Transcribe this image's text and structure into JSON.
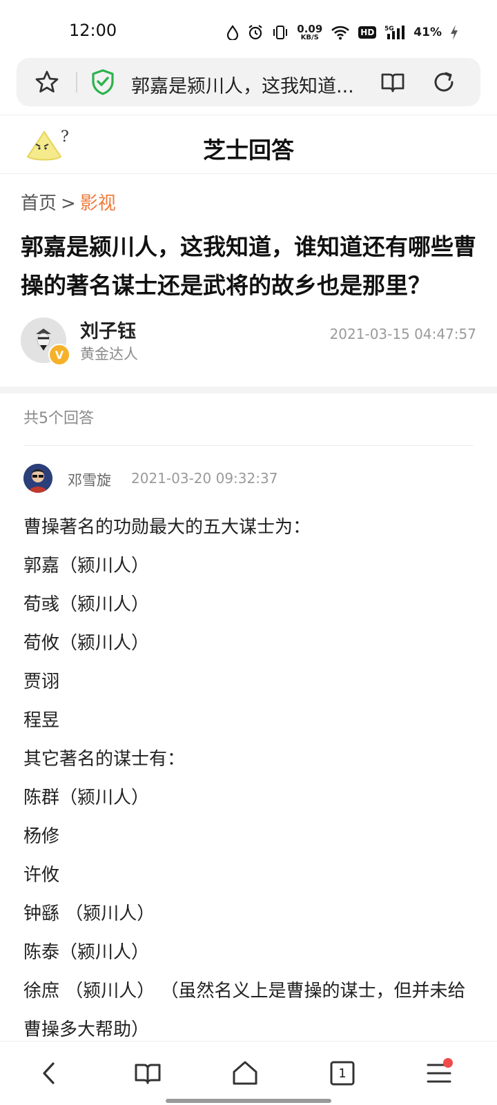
{
  "status_bar": {
    "time": "12:00",
    "net_speed_value": "0.09",
    "net_speed_unit": "KB/S",
    "hd_label": "HD",
    "network_label": "5G",
    "battery": "41%"
  },
  "address_bar": {
    "url_text": "郭嘉是颍川人，这我知道..."
  },
  "site": {
    "title": "芝士回答"
  },
  "breadcrumb": {
    "home": "首页",
    "separator": ">",
    "current": "影视"
  },
  "question": {
    "title": "郭嘉是颍川人，这我知道，谁知道还有哪些曹操的著名谋士还是武将的故乡也是那里？",
    "asker_name": "刘子钰",
    "asker_level": "黄金达人",
    "asker_badge": "V",
    "time": "2021-03-15 04:47:57"
  },
  "answers": {
    "count_label": "共5个回答",
    "first": {
      "author": "邓雪旋",
      "time": "2021-03-20 09:32:37",
      "lines": [
        "曹操著名的功勋最大的五大谋士为：",
        "郭嘉（颍川人）",
        "荀彧（颍川人）",
        "荀攸（颍川人）",
        "贾诩",
        "程昱",
        "其它著名的谋士有：",
        "陈群（颍川人）",
        "杨修",
        "许攸",
        "钟繇 （颍川人）",
        "陈泰（颍川人）",
        "徐庶 （颍川人） （虽然名义上是曹操的谋士，但并未给曹操多大帮助）"
      ]
    }
  },
  "bottom_nav": {
    "tabs_count": "1"
  },
  "colors": {
    "accent_orange": "#f07a3a",
    "shield_green": "#2bb24c",
    "badge_gold": "#f6b12a",
    "notification_red": "#f24b4b"
  }
}
